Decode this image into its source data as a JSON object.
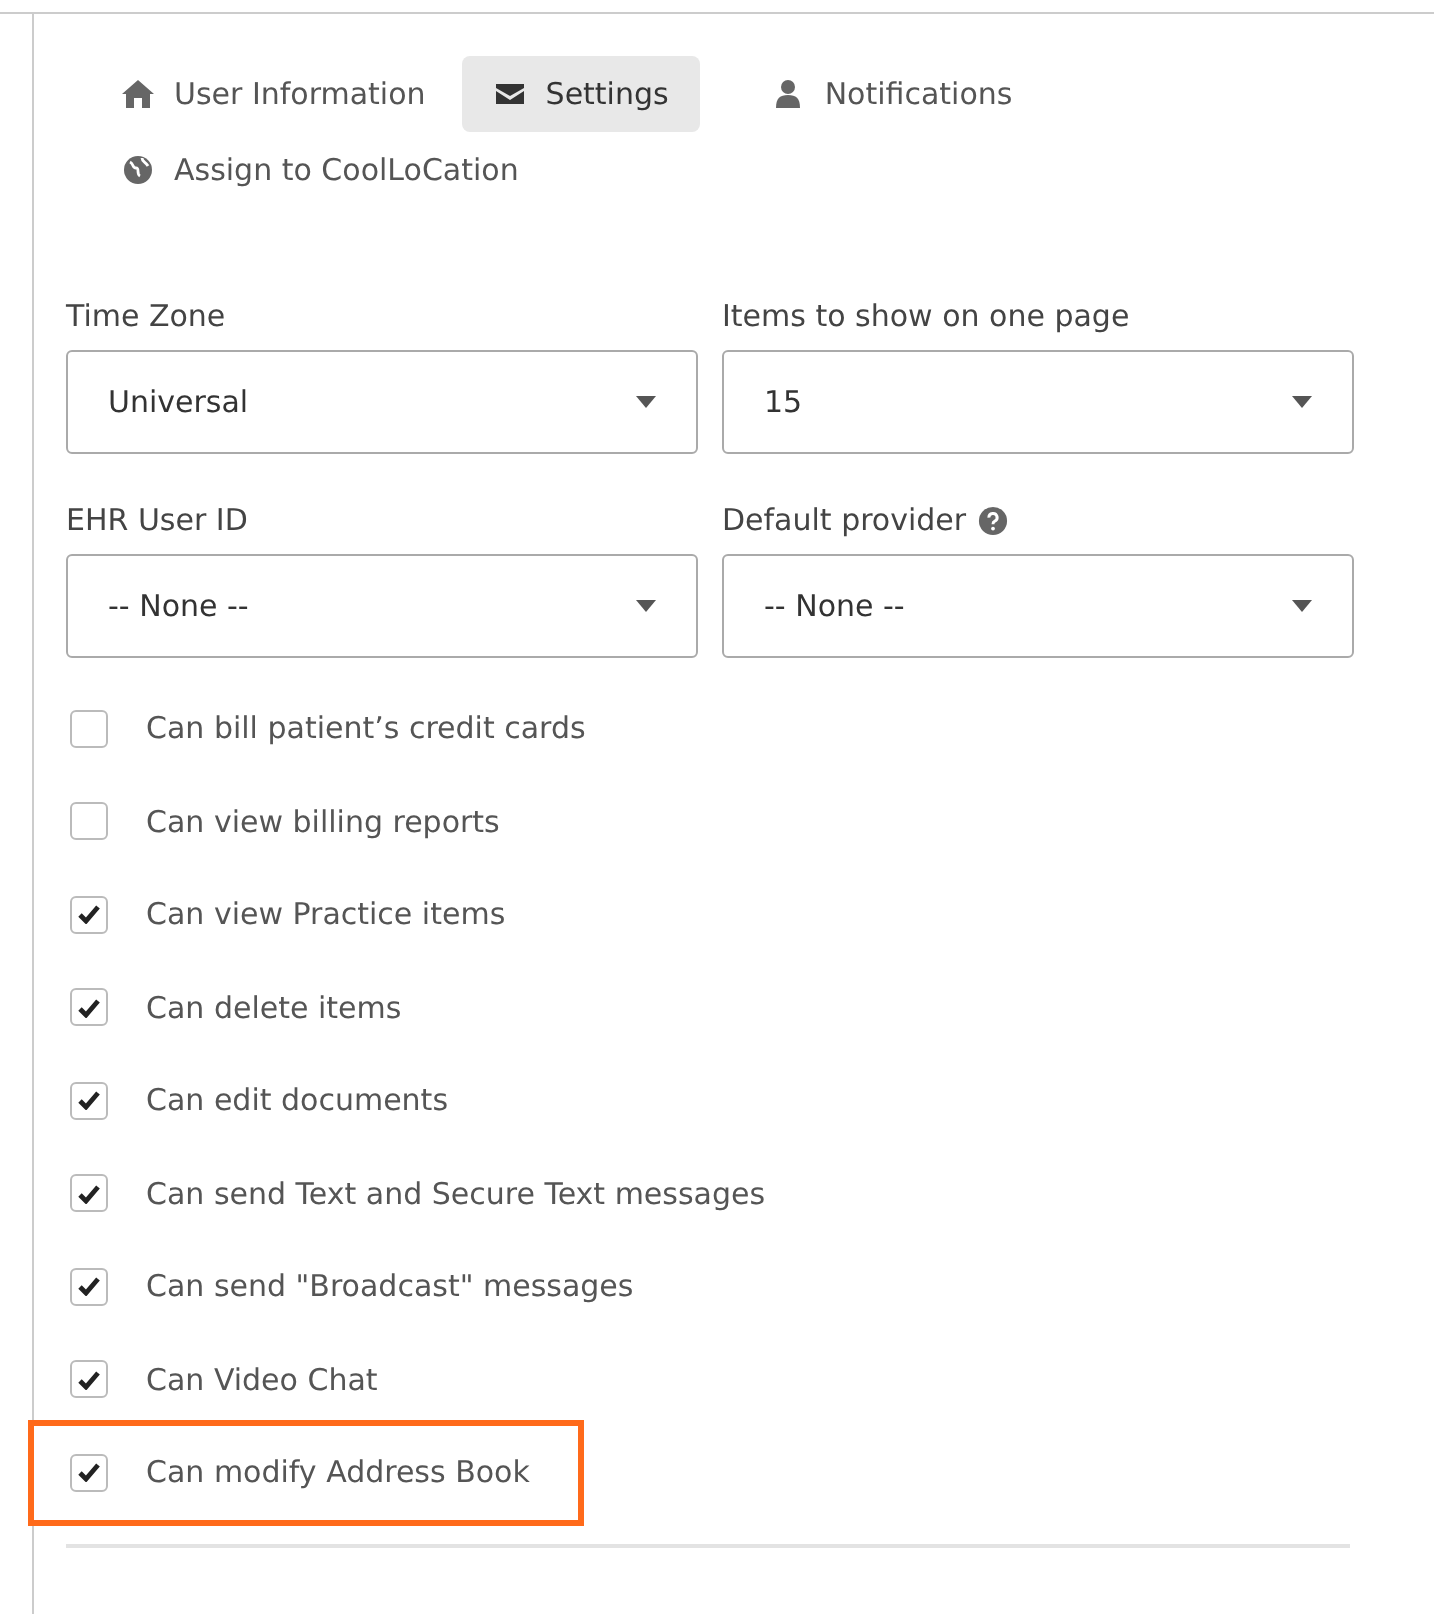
{
  "tabs": [
    {
      "label": "User Information",
      "selected": false
    },
    {
      "label": "Settings",
      "selected": true
    },
    {
      "label": "Notifications",
      "selected": false
    },
    {
      "label": "Assign to CoolLoCation",
      "selected": false
    }
  ],
  "fields": [
    {
      "label": "Time Zone",
      "value": "Universal",
      "help": false
    },
    {
      "label": "Items to show on one page",
      "value": "15",
      "help": false
    },
    {
      "label": "EHR User ID",
      "value": "-- None --",
      "help": false
    },
    {
      "label": "Default provider",
      "value": "-- None --",
      "help": true
    }
  ],
  "permissions": [
    {
      "label": "Can bill patient’s credit cards",
      "checked": false,
      "highlighted": false
    },
    {
      "label": "Can view billing reports",
      "checked": false,
      "highlighted": false
    },
    {
      "label": "Can view Practice items",
      "checked": true,
      "highlighted": false
    },
    {
      "label": "Can delete items",
      "checked": true,
      "highlighted": false
    },
    {
      "label": "Can edit documents",
      "checked": true,
      "highlighted": false
    },
    {
      "label": "Can send Text and Secure Text messages",
      "checked": true,
      "highlighted": false
    },
    {
      "label": "Can send \"Broadcast\" messages",
      "checked": true,
      "highlighted": false
    },
    {
      "label": "Can Video Chat",
      "checked": true,
      "highlighted": false
    },
    {
      "label": "Can modify Address Book",
      "checked": true,
      "highlighted": true
    }
  ]
}
